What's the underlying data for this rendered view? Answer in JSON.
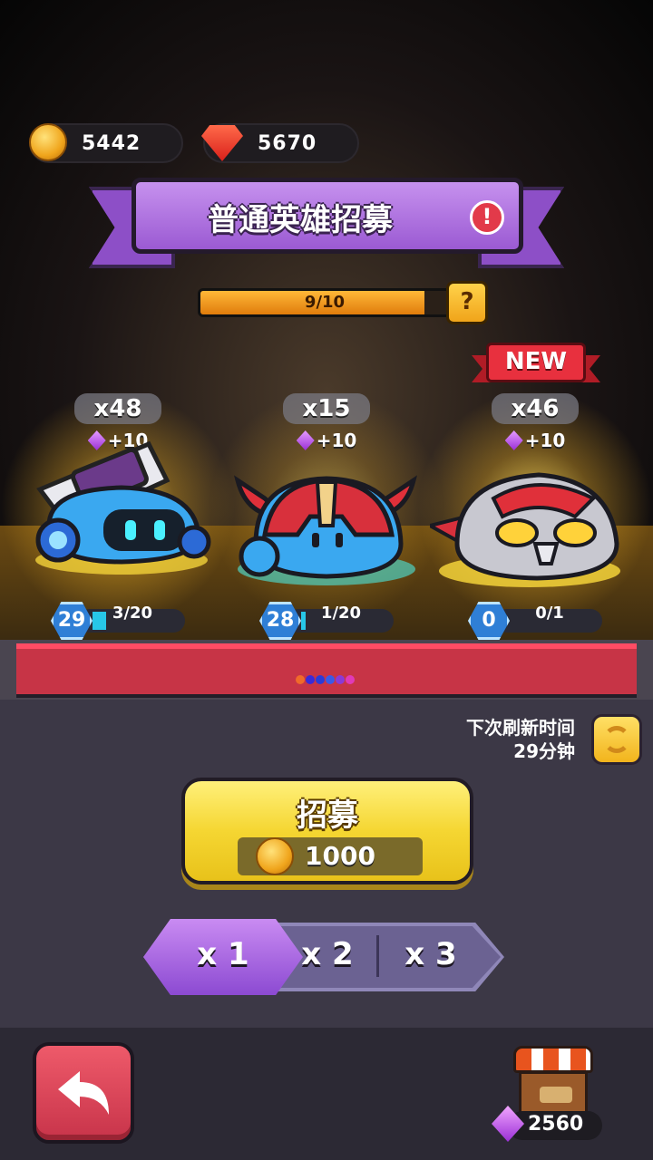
{
  "currency": {
    "gold": "5442",
    "gems": "5670"
  },
  "banner": {
    "title": "普通英雄招募"
  },
  "progress": {
    "label": "9/10",
    "value": 9,
    "max": 10,
    "help": "?"
  },
  "heroes": [
    {
      "count": "x48",
      "bonus": "+10",
      "level": "29",
      "shards": "3/20",
      "shard_fraction": 0.15,
      "is_new": false
    },
    {
      "count": "x15",
      "bonus": "+10",
      "level": "28",
      "shards": "1/20",
      "shard_fraction": 0.05,
      "is_new": false
    },
    {
      "count": "x46",
      "bonus": "+10",
      "level": "0",
      "shards": "0/1",
      "shard_fraction": 0,
      "is_new": true
    }
  ],
  "new_badge": "NEW",
  "pager": {
    "dot_colors": [
      "#f06a2a",
      "#3a2ad8",
      "#2a3ad8",
      "#3a5ae8",
      "#8a3ad8",
      "#e03ab8"
    ]
  },
  "refresh": {
    "line1": "下次刷新时间",
    "line2": "29分钟"
  },
  "recruit": {
    "label": "招募",
    "cost": "1000"
  },
  "multipliers": [
    {
      "label": "x 1",
      "selected": true
    },
    {
      "label": "x 2",
      "selected": false
    },
    {
      "label": "x 3",
      "selected": false
    }
  ],
  "shop": {
    "price": "2560"
  },
  "colors": {
    "accent_purple": "#9b5ad3",
    "gold": "#f5d632",
    "back_red": "#c8344a"
  }
}
